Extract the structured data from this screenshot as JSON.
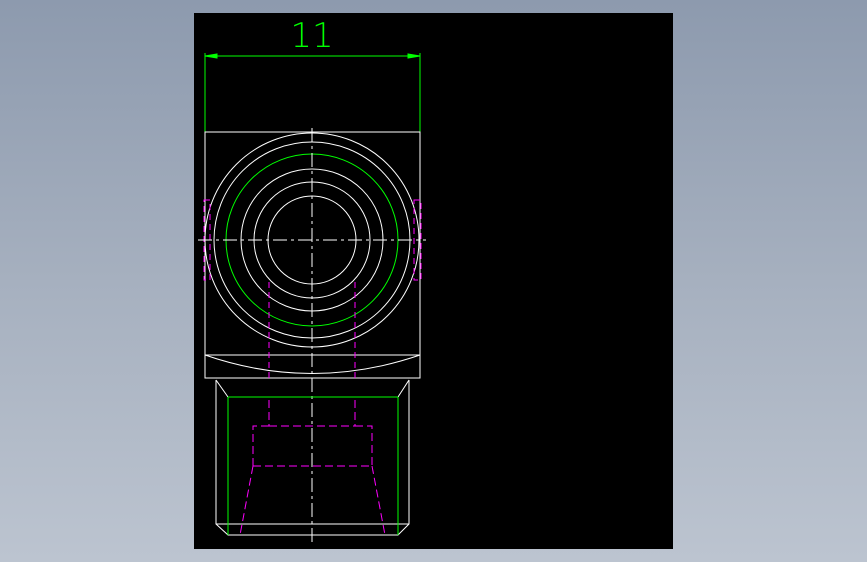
{
  "drawing": {
    "dimension_label": "11",
    "colors": {
      "background": "#000000",
      "outline": "#ffffff",
      "dimension": "#00ff00",
      "hidden": "#ff00ff",
      "page_bg": "#a2acbc"
    }
  }
}
